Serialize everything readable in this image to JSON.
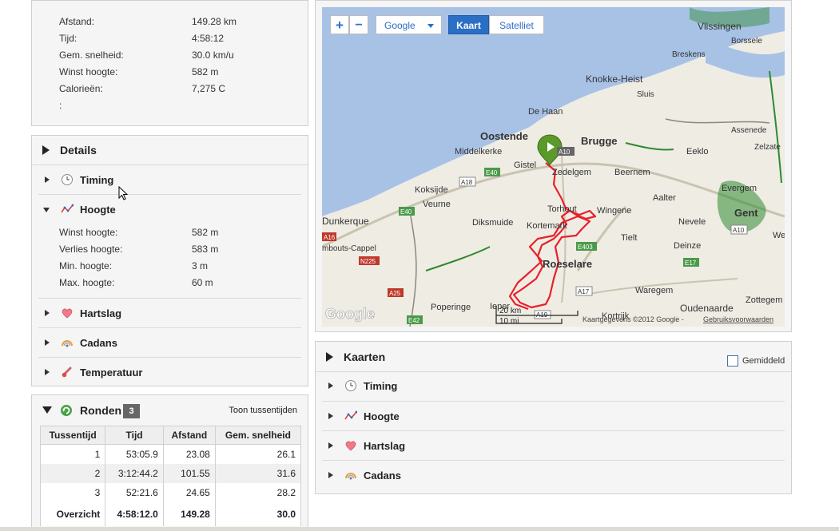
{
  "summary": {
    "rows": [
      {
        "label": "Afstand:",
        "value": "149.28 km"
      },
      {
        "label": "Tijd:",
        "value": "4:58:12"
      },
      {
        "label": "Gem. snelheid:",
        "value": "30.0 km/u"
      },
      {
        "label": "Winst hoogte:",
        "value": "582 m"
      },
      {
        "label": "Calorieën:",
        "value": "7,275 C"
      },
      {
        "label": ":",
        "value": ""
      }
    ]
  },
  "details": {
    "title": "Details",
    "timing": "Timing",
    "hoogte": "Hoogte",
    "hoogte_rows": [
      {
        "label": "Winst hoogte:",
        "value": "582 m"
      },
      {
        "label": "Verlies hoogte:",
        "value": "583 m"
      },
      {
        "label": "Min. hoogte:",
        "value": "3 m"
      },
      {
        "label": "Max. hoogte:",
        "value": "60 m"
      }
    ],
    "hartslag": "Hartslag",
    "cadans": "Cadans",
    "temperatuur": "Temperatuur"
  },
  "ronden": {
    "title": "Ronden",
    "count": "3",
    "toggle": "Toon tussentijden",
    "columns": [
      "Tussentijd",
      "Tijd",
      "Afstand",
      "Gem. snelheid"
    ],
    "rows": [
      [
        "1",
        "53:05.9",
        "23.08",
        "26.1"
      ],
      [
        "2",
        "3:12:44.2",
        "101.55",
        "31.6"
      ],
      [
        "3",
        "52:21.6",
        "24.65",
        "28.2"
      ]
    ],
    "total": [
      "Overzicht",
      "4:58:12.0",
      "149.28",
      "30.0"
    ]
  },
  "map": {
    "zoom_in": "+",
    "zoom_out": "−",
    "provider": "Google",
    "type_map": "Kaart",
    "type_sat": "Satelliet",
    "scale_km": "20 km",
    "scale_mi": "10 mi",
    "logo": "Google",
    "credits": "Kaartgegevens ©2012 Google -",
    "terms": "Gebruiksvoorwaarden",
    "places": [
      "Vlissingen",
      "Borssele",
      "Breskens",
      "Knokke-Heist",
      "Sluis",
      "De Haan",
      "Oostende",
      "Brugge",
      "Middelkerke",
      "Gistel",
      "Zedelgem",
      "Beernem",
      "Eeklo",
      "Assenede",
      "Zelzate",
      "Koksijde",
      "Veurne",
      "Torhout",
      "Wingene",
      "Aalter",
      "Evergem",
      "Gent",
      "Dunkerque",
      "Diksmuide",
      "Kortemark",
      "Tielt",
      "Nevele",
      "Roeselare",
      "Deinze",
      "mbouts-Cappel",
      "Waregem",
      "Poperinge",
      "Ieper",
      "Kortrijk",
      "Oudenaarde",
      "Zottegem",
      "We"
    ],
    "roads": [
      "A10",
      "E40",
      "A18",
      "E40",
      "A16",
      "N225",
      "E403",
      "E17",
      "A17",
      "A25",
      "E42",
      "A10",
      "A19"
    ]
  },
  "kaarten": {
    "title": "Kaarten",
    "checkbox": "Gemiddeld",
    "items": [
      "Timing",
      "Hoogte",
      "Hartslag",
      "Cadans"
    ]
  },
  "colors": {
    "route": "#e8202a",
    "sea": "#a8c2e6",
    "land": "#efece4",
    "marker": "#5a9a2a",
    "accent": "#2a6fc4"
  }
}
